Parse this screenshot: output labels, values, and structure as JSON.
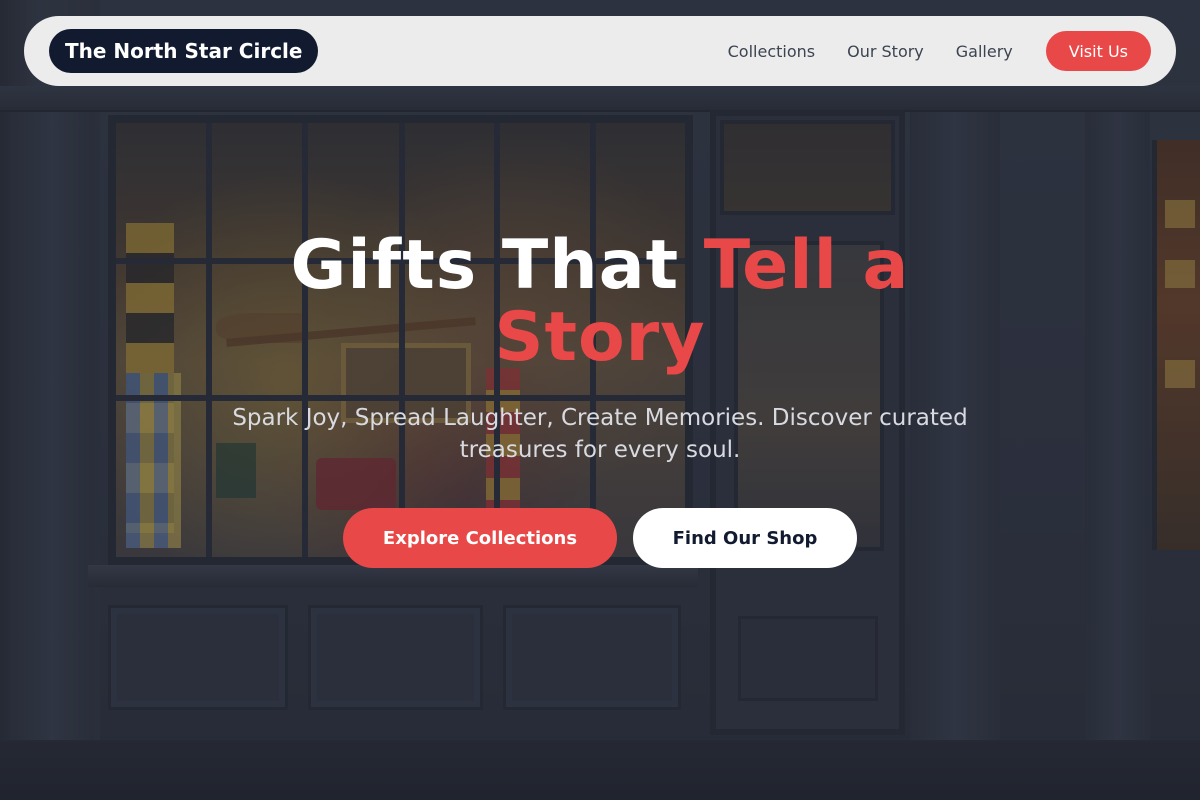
{
  "nav": {
    "brand": "The North Star Circle",
    "links": [
      {
        "label": "Collections"
      },
      {
        "label": "Our Story"
      },
      {
        "label": "Gallery"
      }
    ],
    "cta_label": "Visit Us"
  },
  "hero": {
    "title_main": "Gifts That ",
    "title_accent": "Tell a Story",
    "subtitle": "Spark Joy, Spread Laughter, Create Memories. Discover curated treasures for every soul.",
    "primary_button": "Explore Collections",
    "secondary_button": "Find Our Shop"
  },
  "colors": {
    "accent": "#e94848",
    "brand_dark": "#111a2f",
    "nav_bg": "#ececec"
  }
}
